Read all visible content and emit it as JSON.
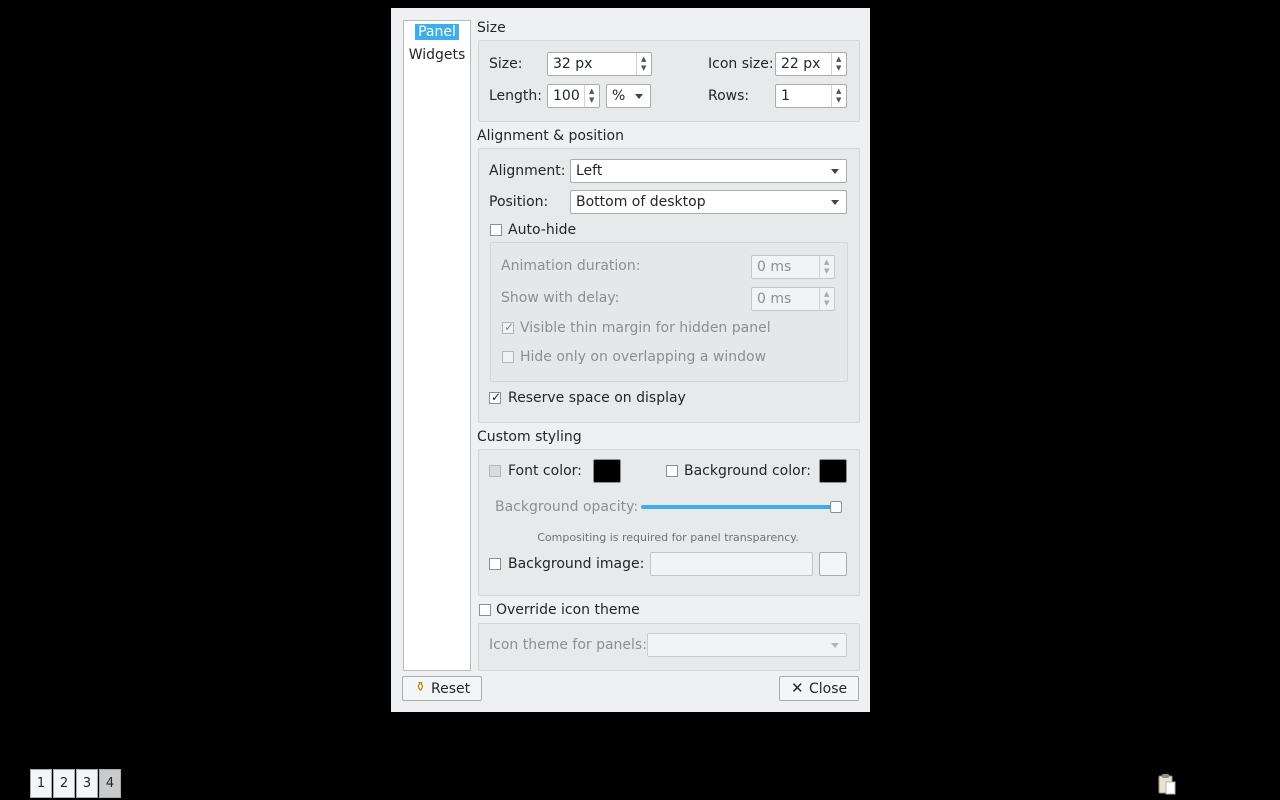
{
  "nav": {
    "items": [
      "Panel",
      "Widgets"
    ],
    "selected": "Panel"
  },
  "size_section": {
    "title": "Size",
    "size_label": "Size:",
    "size_value": "32 px",
    "icon_size_label": "Icon size:",
    "icon_size_value": "22 px",
    "length_label": "Length:",
    "length_value": "100",
    "length_unit": "%",
    "rows_label": "Rows:",
    "rows_value": "1"
  },
  "alignment_section": {
    "title": "Alignment & position",
    "alignment_label": "Alignment:",
    "alignment_value": "Left",
    "position_label": "Position:",
    "position_value": "Bottom of desktop",
    "autohide_label": "Auto-hide",
    "autohide_checked": false,
    "animation_label": "Animation duration:",
    "animation_value": "0 ms",
    "delay_label": "Show with delay:",
    "delay_value": "0 ms",
    "thin_margin_label": "Visible thin margin for hidden panel",
    "thin_margin_checked": true,
    "hide_overlap_label": "Hide only on overlapping a window",
    "hide_overlap_checked": false,
    "reserve_label": "Reserve space on display",
    "reserve_checked": true
  },
  "styling_section": {
    "title": "Custom styling",
    "font_color_label": "Font color:",
    "bg_color_label": "Background color:",
    "font_color": "#000000",
    "bg_color": "#000000",
    "opacity_label": "Background opacity:",
    "opacity_value": 1.0,
    "compositing_note": "Compositing is required for panel transparency.",
    "bg_image_label": "Background image:"
  },
  "icon_theme": {
    "override_label": "Override icon theme",
    "theme_label": "Icon theme for panels:"
  },
  "buttons": {
    "reset": "Reset",
    "close": "Close"
  },
  "taskbar": {
    "desktops": [
      "1",
      "2",
      "3",
      "4"
    ],
    "active_desktop": "4"
  },
  "colors": {
    "accent": "#3daee9",
    "window_bg": "#eff0f1",
    "desktop_bg": "#000000"
  }
}
